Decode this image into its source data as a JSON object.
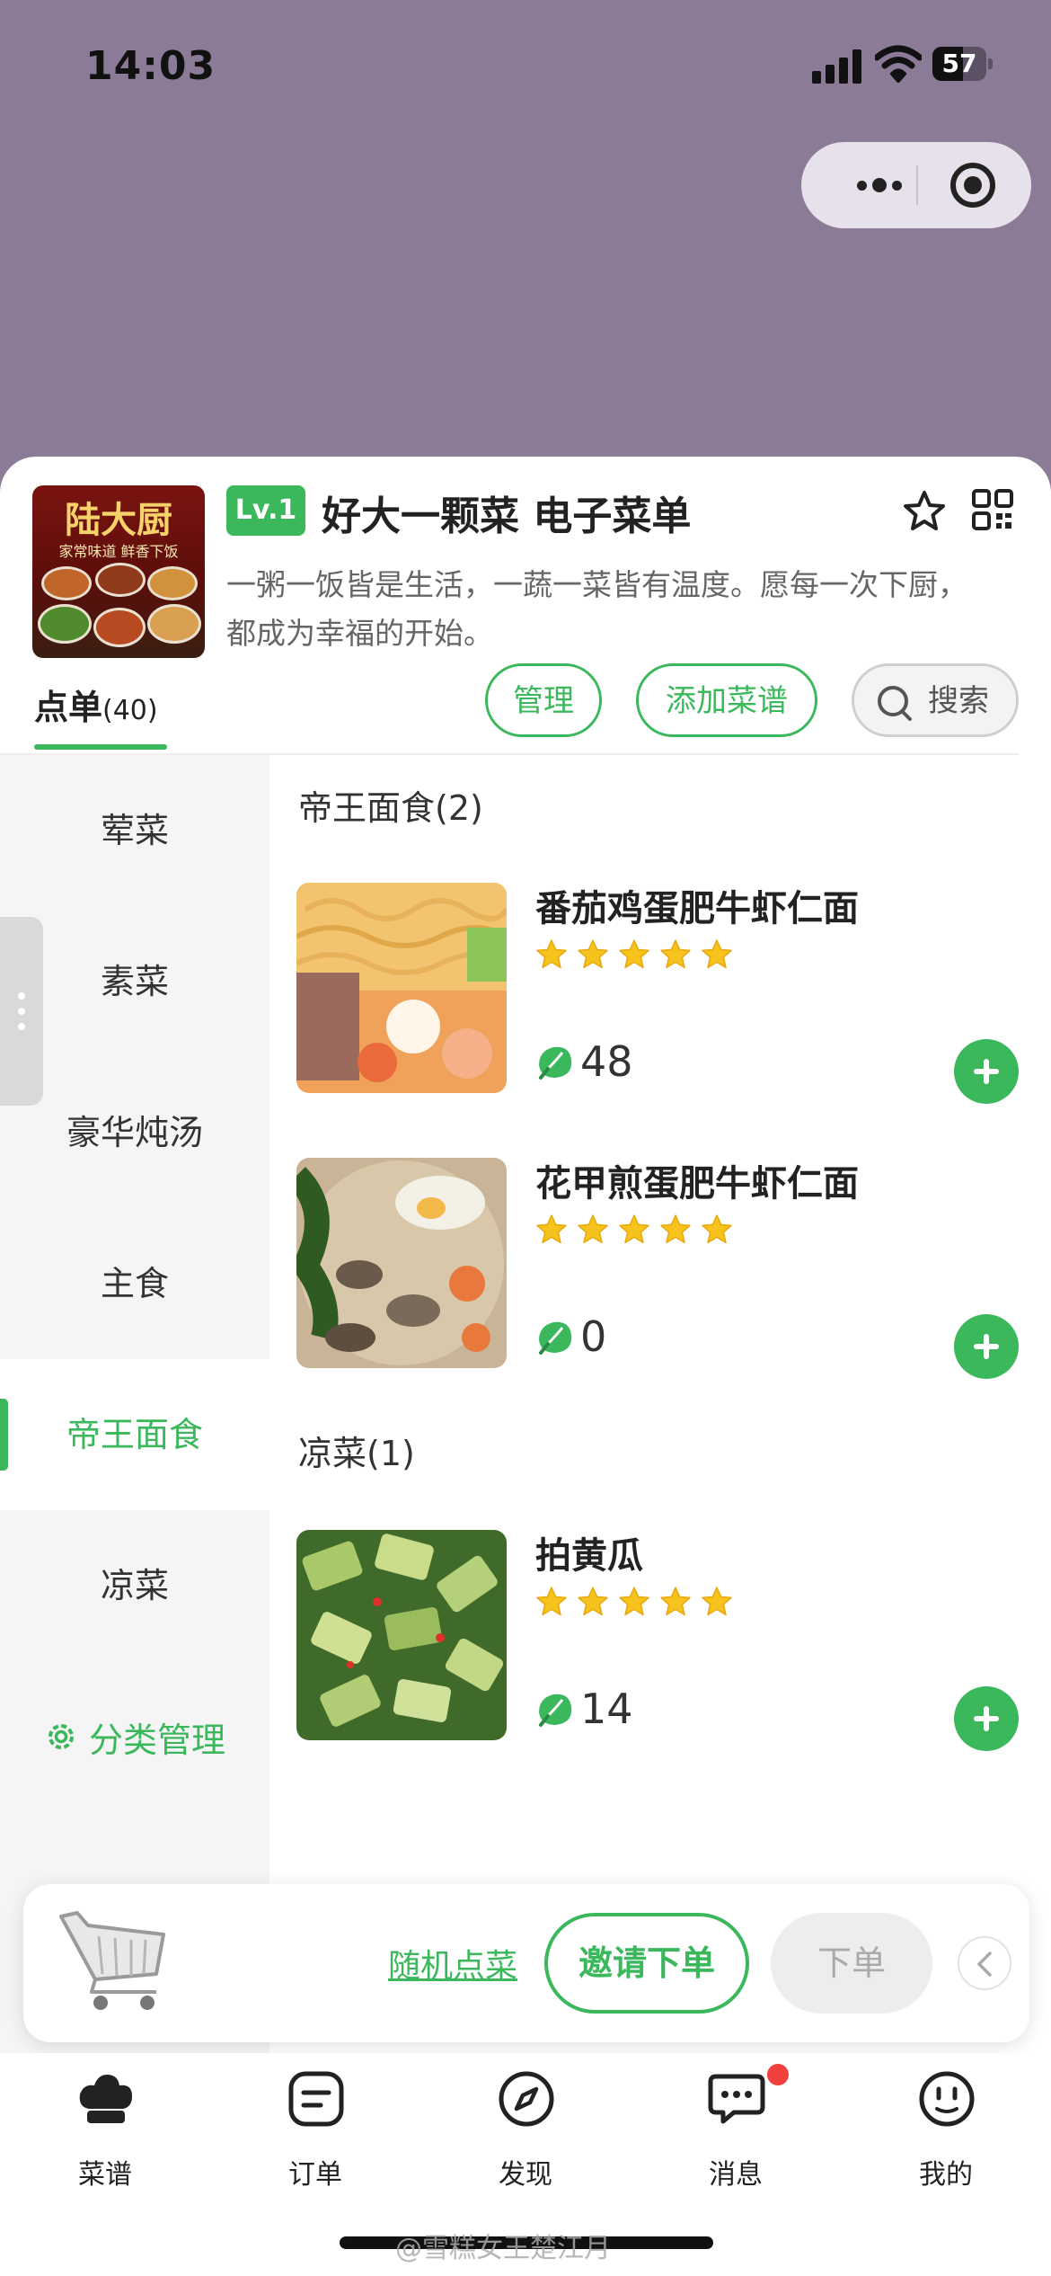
{
  "status_bar": {
    "time": "14:03",
    "battery": "57",
    "battery_level": 0.57
  },
  "header": {
    "cover_title": "陆大厨",
    "cover_subtitle": "家常味道 鲜香下饭",
    "level_badge": "Lv.1",
    "shop_name": "好大一颗菜 电子菜单",
    "slogan": "一粥一饭皆是生活，一蔬一菜皆有温度。愿每一次下厨，都成为幸福的开始。",
    "tab_label": "点单",
    "tab_count": "(40)",
    "manage_label": "管理",
    "add_recipe_label": "添加菜谱",
    "search_label": "搜索"
  },
  "sidebar": {
    "categories": [
      {
        "label": "荤菜",
        "active": false
      },
      {
        "label": "素菜",
        "active": false
      },
      {
        "label": "豪华炖汤",
        "active": false
      },
      {
        "label": "主食",
        "active": false
      },
      {
        "label": "帝王面食",
        "active": true
      },
      {
        "label": "凉菜",
        "active": false
      }
    ],
    "manage_label": "分类管理"
  },
  "sections": [
    {
      "title": "帝王面食(2)",
      "dishes": [
        {
          "name": "番茄鸡蛋肥牛虾仁面",
          "stars": 5,
          "count": "48"
        },
        {
          "name": "花甲煎蛋肥牛虾仁面",
          "stars": 5,
          "count": "0"
        }
      ]
    },
    {
      "title": "凉菜(1)",
      "dishes": [
        {
          "name": "拍黄瓜",
          "stars": 5,
          "count": "14"
        }
      ]
    }
  ],
  "cart_bar": {
    "random_label": "随机点菜",
    "invite_label": "邀请下单",
    "order_label": "下单"
  },
  "bottom_nav": [
    {
      "label": "菜谱",
      "icon": "chef-hat-icon",
      "active": true
    },
    {
      "label": "订单",
      "icon": "order-list-icon",
      "active": false
    },
    {
      "label": "发现",
      "icon": "compass-icon",
      "active": false
    },
    {
      "label": "消息",
      "icon": "message-icon",
      "active": false,
      "badge": true
    },
    {
      "label": "我的",
      "icon": "profile-face-icon",
      "active": false
    }
  ],
  "watermark": "@雪糕女王楚江月",
  "colors": {
    "accent": "#3cb85c",
    "backdrop": "#8c7b96",
    "badge_red": "#f0413c"
  }
}
